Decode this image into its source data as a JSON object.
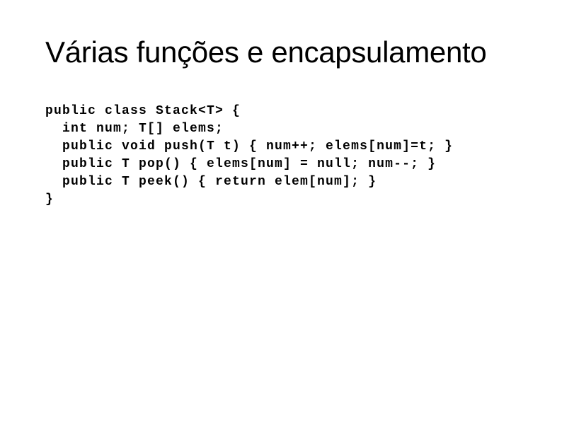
{
  "slide": {
    "title": "Várias funções e encapsulamento",
    "code_lines": [
      "public class Stack<T> {",
      "  int num; T[] elems;",
      "  public void push(T t) { num++; elems[num]=t; }",
      "  public T pop() { elems[num] = null; num--; }",
      "  public T peek() { return elem[num]; }",
      "}"
    ]
  }
}
